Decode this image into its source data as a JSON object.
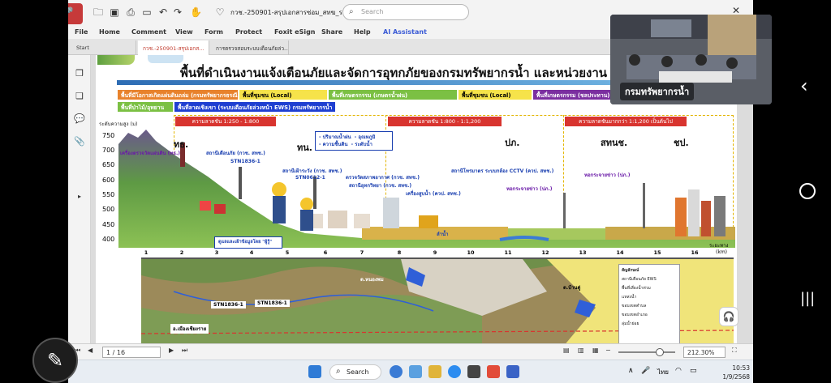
{
  "pdf_app": {
    "doc_name": "กวช.-250901-สรุปเอกสารซ่อม_สทฆ_รวม_v1.0...",
    "search_placeholder": "Search",
    "menu": [
      "File",
      "Home",
      "Comment",
      "View",
      "Form",
      "Protect",
      "Foxit eSign",
      "Share",
      "Help",
      "AI Assistant"
    ],
    "tabs": [
      "Start",
      "กวช.-250901-สรุปเอกส...",
      "การตรวจสอบระบบเตือนภัยล่ว..."
    ],
    "page_indicator": "1 / 16",
    "zoom_level": "212.30%"
  },
  "slide": {
    "title": "พื้นที่ดำเนินงานแจ้งเตือนภัยและจัดการอุทกภัยของกรมทรัพยากรน้ำ และหน่วยงาน",
    "zones": [
      {
        "label": "พื้นที่มีโอกาสเกิดแผ่นดินถล่ม (กรมทรัพยากรธรณี)",
        "color": "#e8822c",
        "text_color": "#ffffff"
      },
      {
        "label": "พื้นที่ชุมชน (Local)",
        "color": "#f6e34a",
        "text_color": "#000000"
      },
      {
        "label": "พื้นที่เกษตรกรรม (เกษตรน้ำฝน)",
        "color": "#7bc043",
        "text_color": "#ffffff"
      },
      {
        "label": "พื้นที่ชุมชน (Local)",
        "color": "#f6e34a",
        "text_color": "#000000"
      },
      {
        "label": "พื้นที่เกษตรกรรม (ชลประทาน)",
        "color": "#7b2fa0",
        "text_color": "#ffffff"
      },
      {
        "label": "พื้นที่ป่าไม้/อุทยาน",
        "color": "#7bc043",
        "text_color": "#ffffff"
      },
      {
        "label": "พื้นที่ลาดเชิงเขา (ระบบเตือนภัยล่วงหน้า EWS) กรมทรัพยากรน้ำ",
        "color": "#1f3fd1",
        "text_color": "#ffffff"
      }
    ],
    "slope_bars": [
      "ความลาดชัน 1:250 - 1:800",
      "ความลาดชัน 1:800 - 1:1,200",
      "ความลาดชันมากกว่า 1:1,200 เป็นต้นไป"
    ],
    "y_axis_label": "ระดับความสูง (ม)",
    "y_ticks": [
      "750",
      "700",
      "650",
      "600",
      "550",
      "500",
      "450",
      "400"
    ],
    "x_ticks": [
      "1",
      "2",
      "3",
      "4",
      "5",
      "6",
      "7",
      "8",
      "9",
      "10",
      "11",
      "12",
      "13",
      "14",
      "15",
      "16"
    ],
    "x_unit_label": "ระยะทาง",
    "x_unit": "(km)",
    "places": [
      "ทธ.",
      "ทน.",
      "ปภ.",
      "สทนช.",
      "ชป."
    ],
    "station_labels": [
      "เครื่องตรวจวัดแผ่นดิน (ทธ.)",
      "สถานีเตือนภัย (กวช. สทช.)",
      "STN1836-1",
      "สถานีเฝ้าระวัง (กวช. สทช.)",
      "STN0612-1",
      "ตรวจวัดสภาพอากาศ (กวช. สทช.)",
      "สถานีอุทกวิทยา (กวช. สทช.)",
      "เครื่องสูบน้ำ (ควป. สทช.)",
      "สถานีโทรมาตร ระบบกล้อง CCTV (ควป. สทช.)",
      "หอกระจายข่าว (ปภ.)",
      "หอกระจายข่าว (ปภ.)",
      "ลำน้ำ"
    ],
    "callout_lines": [
      "- ปริมาณน้ำฝน",
      "- อุณหภูมิ",
      "- ความชื้นดิน",
      "- ระดับน้ำ"
    ],
    "volunteer_label": "ดูแลและเฝ้าข้อมูลโดย \"ผู้รู้\"",
    "map_labels": [
      "STN1836-1",
      "STN1836-1",
      "อ.เมืองเชียงราย",
      "ต.หนองพม",
      "ต.บ้านดู่"
    ],
    "legend_title": "สัญลักษณ์",
    "legend_items": [
      "สถานีเตือนภัย EWS",
      "พื้นที่เสี่ยงน้ำท่วม",
      "แหล่งน้ำ",
      "ขอบเขตตำบล",
      "ขอบเขตอำเภอ",
      "ลุ่มน้ำย่อย"
    ]
  },
  "video": {
    "caption": "กรมทรัพยากรน้ำ"
  },
  "taskbar": {
    "search_label": "Search",
    "language": "ไทย",
    "time": "10:53",
    "date": "1/9/2568"
  },
  "colors": {
    "slope_bar": "#d8342f",
    "callout_border": "#1a3fb0",
    "accent_ai": "#3b5bd6"
  }
}
